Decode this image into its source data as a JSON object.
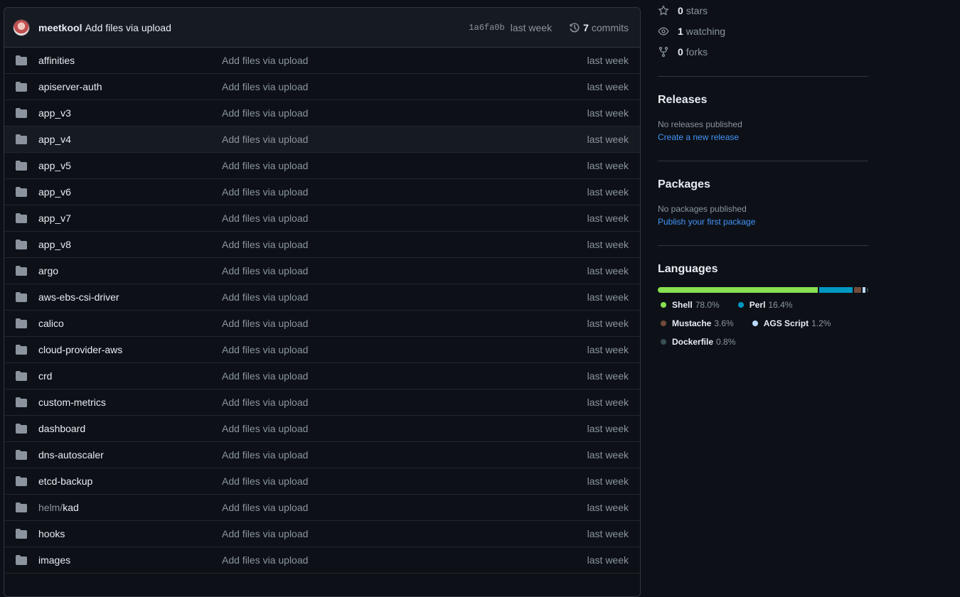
{
  "commit": {
    "author": "meetkool",
    "message": "Add files via upload",
    "sha": "1a6fa0b",
    "time": "last week",
    "commit_count": "7",
    "commit_word": "commits"
  },
  "files": [
    {
      "prefix": "",
      "name": "affinities",
      "message": "Add files via upload",
      "time": "last week"
    },
    {
      "prefix": "",
      "name": "apiserver-auth",
      "message": "Add files via upload",
      "time": "last week"
    },
    {
      "prefix": "",
      "name": "app_v3",
      "message": "Add files via upload",
      "time": "last week"
    },
    {
      "prefix": "",
      "name": "app_v4",
      "message": "Add files via upload",
      "time": "last week"
    },
    {
      "prefix": "",
      "name": "app_v5",
      "message": "Add files via upload",
      "time": "last week"
    },
    {
      "prefix": "",
      "name": "app_v6",
      "message": "Add files via upload",
      "time": "last week"
    },
    {
      "prefix": "",
      "name": "app_v7",
      "message": "Add files via upload",
      "time": "last week"
    },
    {
      "prefix": "",
      "name": "app_v8",
      "message": "Add files via upload",
      "time": "last week"
    },
    {
      "prefix": "",
      "name": "argo",
      "message": "Add files via upload",
      "time": "last week"
    },
    {
      "prefix": "",
      "name": "aws-ebs-csi-driver",
      "message": "Add files via upload",
      "time": "last week"
    },
    {
      "prefix": "",
      "name": "calico",
      "message": "Add files via upload",
      "time": "last week"
    },
    {
      "prefix": "",
      "name": "cloud-provider-aws",
      "message": "Add files via upload",
      "time": "last week"
    },
    {
      "prefix": "",
      "name": "crd",
      "message": "Add files via upload",
      "time": "last week"
    },
    {
      "prefix": "",
      "name": "custom-metrics",
      "message": "Add files via upload",
      "time": "last week"
    },
    {
      "prefix": "",
      "name": "dashboard",
      "message": "Add files via upload",
      "time": "last week"
    },
    {
      "prefix": "",
      "name": "dns-autoscaler",
      "message": "Add files via upload",
      "time": "last week"
    },
    {
      "prefix": "",
      "name": "etcd-backup",
      "message": "Add files via upload",
      "time": "last week"
    },
    {
      "prefix": "helm/",
      "name": "kad",
      "message": "Add files via upload",
      "time": "last week"
    },
    {
      "prefix": "",
      "name": "hooks",
      "message": "Add files via upload",
      "time": "last week"
    },
    {
      "prefix": "",
      "name": "images",
      "message": "Add files via upload",
      "time": "last week"
    }
  ],
  "stats": {
    "stars_count": "0",
    "stars_label": "stars",
    "watching_count": "1",
    "watching_label": "watching",
    "forks_count": "0",
    "forks_label": "forks"
  },
  "releases": {
    "title": "Releases",
    "empty": "No releases published",
    "link": "Create a new release"
  },
  "packages": {
    "title": "Packages",
    "empty": "No packages published",
    "link": "Publish your first package"
  },
  "languages": {
    "title": "Languages",
    "items": [
      {
        "name": "Shell",
        "percent": "78.0%",
        "value": 78.0,
        "color": "#89e051"
      },
      {
        "name": "Perl",
        "percent": "16.4%",
        "value": 16.4,
        "color": "#0298c3"
      },
      {
        "name": "Mustache",
        "percent": "3.6%",
        "value": 3.6,
        "color": "#724b3b"
      },
      {
        "name": "AGS Script",
        "percent": "1.2%",
        "value": 1.2,
        "color": "#b9d9ff"
      },
      {
        "name": "Dockerfile",
        "percent": "0.8%",
        "value": 0.8,
        "color": "#384d54"
      }
    ]
  }
}
